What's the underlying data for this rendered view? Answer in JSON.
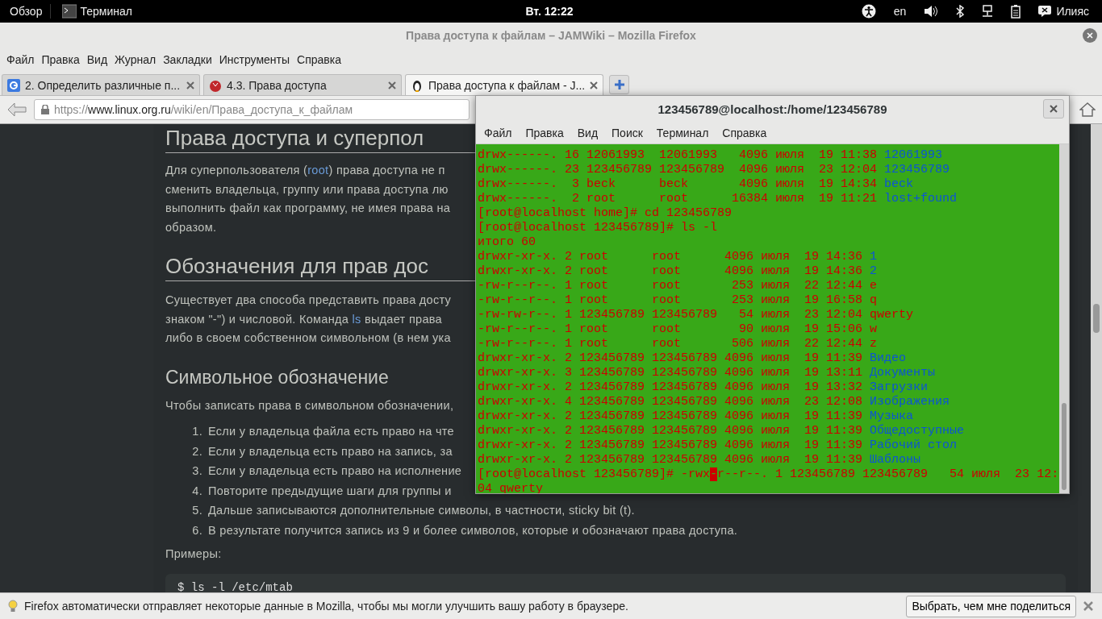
{
  "top_bar": {
    "activities": "Обзор",
    "app": "Терминал",
    "clock": "Вт. 12:22",
    "language": "en",
    "user": "Илияс"
  },
  "browser": {
    "title": "Права доступа к файлам – JAMWiki – Mozilla Firefox",
    "menu": [
      "Файл",
      "Правка",
      "Вид",
      "Журнал",
      "Закладки",
      "Инструменты",
      "Справка"
    ],
    "tabs": [
      {
        "label": "2. Определить различные п...",
        "selected": false
      },
      {
        "label": "4.3. Права доступа",
        "selected": false
      },
      {
        "label": "Права доступа к файлам - J...",
        "selected": true
      }
    ],
    "url": {
      "scheme": "https://",
      "host": "www.linux.org.ru",
      "path": "/wiki/en/Права_доступа_к_файлам"
    }
  },
  "article": [
    {
      "kind": "h1",
      "text": "Права доступа и суперпол"
    },
    {
      "kind": "p",
      "lines": [
        [
          {
            "text": "Для суперпользователя ("
          },
          {
            "text": "root",
            "kind": "link"
          },
          {
            "text": ") права доступа не п"
          }
        ],
        [
          {
            "text": "сменить владельца, группу или права доступа лю"
          }
        ],
        [
          {
            "text": "выполнить файл как программу, не имея права на"
          }
        ],
        [
          {
            "text": "образом."
          }
        ]
      ]
    },
    {
      "kind": "h2",
      "text": "Обозначения для прав дос"
    },
    {
      "kind": "p",
      "lines": [
        [
          {
            "text": "Существует два способа представить права досту"
          }
        ],
        [
          {
            "text": "знаком \"-\") и числовой. Команда "
          },
          {
            "text": "ls",
            "kind": "link"
          },
          {
            "text": " выдает права"
          }
        ],
        [
          {
            "text": "либо в своем собственном символьном (в нем ука"
          }
        ]
      ]
    },
    {
      "kind": "h3",
      "text": "Символьное обозначение"
    },
    {
      "kind": "p",
      "lines": [
        [
          {
            "text": "Чтобы записать права в символьном обозначении,"
          }
        ]
      ]
    },
    {
      "kind": "ol",
      "items": [
        {
          "number": "1.",
          "text": "Если у владельца файла есть право на чте"
        },
        {
          "number": "2.",
          "text": "Если у владельца есть право на запись, за"
        },
        {
          "number": "3.",
          "text": "Если у владельца есть право на исполнение"
        },
        {
          "number": "4.",
          "text": "Повторите предыдущие шаги для группы и"
        },
        {
          "number": "5.",
          "text": "Дальше записываются дополнительные символы, в частности, sticky bit (t)."
        },
        {
          "number": "6.",
          "text": "В результате получится запись из 9 и более символов, которые и обозначают права доступа."
        }
      ]
    },
    {
      "kind": "p",
      "lines": [
        [
          {
            "text": "Примеры:"
          }
        ]
      ]
    },
    {
      "kind": "code",
      "text": "$ ls -l /etc/mtab"
    }
  ],
  "terminal": {
    "title": "123456789@localhost:/home/123456789",
    "menu": [
      "Файл",
      "Правка",
      "Вид",
      "Поиск",
      "Терминал",
      "Справка"
    ],
    "lines": [
      {
        "kind": "dir",
        "text": "drwx------. 16 12061993  12061993   4096 июля  19 11:38 ",
        "name": "12061993"
      },
      {
        "kind": "dir",
        "text": "drwx------. 23 123456789 123456789  4096 июля  23 12:04 ",
        "name": "123456789"
      },
      {
        "kind": "dir",
        "text": "drwx------.  3 beck      beck       4096 июля  19 14:34 ",
        "name": "beck"
      },
      {
        "kind": "dir",
        "text": "drwx------.  2 root      root      16384 июля  19 11:21 ",
        "name": "lost+found"
      },
      {
        "kind": "line",
        "text": "[root@localhost home]# cd 123456789"
      },
      {
        "kind": "line",
        "text": "[root@localhost 123456789]# ls -l"
      },
      {
        "kind": "line",
        "text": "итого 60"
      },
      {
        "kind": "dir",
        "text": "drwxr-xr-x. 2 root      root      4096 июля  19 14:36 ",
        "name": "1"
      },
      {
        "kind": "dir",
        "text": "drwxr-xr-x. 2 root      root      4096 июля  19 14:36 ",
        "name": "2"
      },
      {
        "kind": "file",
        "text": "-rw-r--r--. 1 root      root       253 июля  22 12:44 ",
        "name": "e"
      },
      {
        "kind": "file",
        "text": "-rw-r--r--. 1 root      root       253 июля  19 16:58 ",
        "name": "q"
      },
      {
        "kind": "file",
        "text": "-rw-rw-r--. 1 123456789 123456789   54 июля  23 12:04 ",
        "name": "qwerty"
      },
      {
        "kind": "file",
        "text": "-rw-r--r--. 1 root      root        90 июля  19 15:06 ",
        "name": "w"
      },
      {
        "kind": "file",
        "text": "-rw-r--r--. 1 root      root       506 июля  22 12:44 ",
        "name": "z"
      },
      {
        "kind": "dir",
        "text": "drwxr-xr-x. 2 123456789 123456789 4096 июля  19 11:39 ",
        "name": "Видео"
      },
      {
        "kind": "dir",
        "text": "drwxr-xr-x. 3 123456789 123456789 4096 июля  19 13:11 ",
        "name": "Документы"
      },
      {
        "kind": "dir",
        "text": "drwxr-xr-x. 2 123456789 123456789 4096 июля  19 13:32 ",
        "name": "Загрузки"
      },
      {
        "kind": "dir",
        "text": "drwxr-xr-x. 4 123456789 123456789 4096 июля  23 12:08 ",
        "name": "Изображения"
      },
      {
        "kind": "dir",
        "text": "drwxr-xr-x. 2 123456789 123456789 4096 июля  19 11:39 ",
        "name": "Музыка"
      },
      {
        "kind": "dir",
        "text": "drwxr-xr-x. 2 123456789 123456789 4096 июля  19 11:39 ",
        "name": "Общедоступные"
      },
      {
        "kind": "dir",
        "text": "drwxr-xr-x. 2 123456789 123456789 4096 июля  19 11:39 ",
        "name": "Рабочий стол"
      },
      {
        "kind": "dir",
        "text": "drwxr-xr-x. 2 123456789 123456789 4096 июля  19 11:39 ",
        "name": "Шаблоны"
      },
      {
        "kind": "cursor",
        "text": "[root@localhost 123456789]# -rwx",
        "cursor": "-",
        "after": "r--r--. 1 123456789 123456789   54 июля  23 12:"
      },
      {
        "kind": "line",
        "text": "04 qwerty"
      }
    ]
  },
  "notification": {
    "text": "Firefox автоматически отправляет некоторые данные в Mozilla, чтобы мы могли улучшить вашу работу в браузере.",
    "button": "Выбрать, чем мне поделиться"
  }
}
